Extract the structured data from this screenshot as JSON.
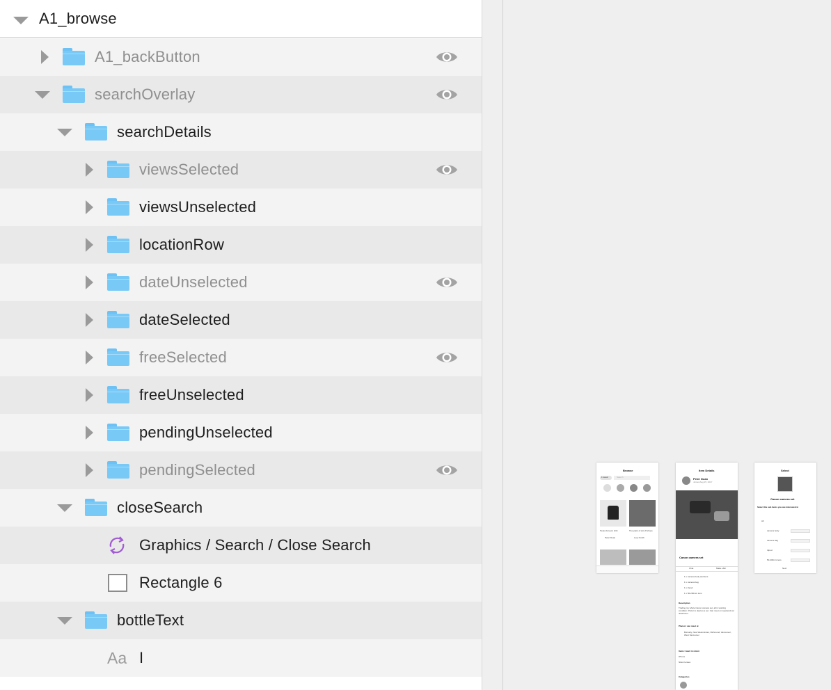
{
  "layers": {
    "root_label": "A1_browse",
    "rows": [
      {
        "label": "A1_backButton",
        "hidden": true,
        "eye": true
      },
      {
        "label": "searchOverlay",
        "hidden": true,
        "eye": true
      },
      {
        "label": "searchDetails",
        "hidden": false,
        "eye": false
      },
      {
        "label": "viewsSelected",
        "hidden": true,
        "eye": true
      },
      {
        "label": "viewsUnselected",
        "hidden": false,
        "eye": false
      },
      {
        "label": "locationRow",
        "hidden": false,
        "eye": false
      },
      {
        "label": "dateUnselected",
        "hidden": true,
        "eye": true
      },
      {
        "label": "dateSelected",
        "hidden": false,
        "eye": false
      },
      {
        "label": "freeSelected",
        "hidden": true,
        "eye": true
      },
      {
        "label": "freeUnselected",
        "hidden": false,
        "eye": false
      },
      {
        "label": "pendingUnselected",
        "hidden": false,
        "eye": false
      },
      {
        "label": "pendingSelected",
        "hidden": true,
        "eye": true
      },
      {
        "label": "closeSearch",
        "hidden": false,
        "eye": false
      },
      {
        "label": "Graphics / Search / Close Search",
        "hidden": false,
        "eye": false
      },
      {
        "label": "Rectangle 6",
        "hidden": false,
        "eye": false
      },
      {
        "label": "bottleText",
        "hidden": false,
        "eye": false
      },
      {
        "label": "I",
        "hidden": false,
        "eye": false
      }
    ]
  },
  "artboards": {
    "browse": {
      "title": "Browse",
      "search_placeholder": "Search",
      "chip": "1 week",
      "item1": "Texas Forever shirt",
      "item2": "Two pairs of size 8 shoes",
      "user1": "Peter Duan",
      "user2": "Lucy Smith"
    },
    "item_details": {
      "title": "Item Details",
      "user": "Peter Duan",
      "posted": "Joined Aug 25, 2017",
      "item_name": "Canon camera set",
      "tab_chat": "Chat",
      "tab_offer": "Make offer",
      "list": [
        "1 x camera body and lens",
        "1 x camera bag",
        "1 x tripod",
        "1 x 50-200mm lens"
      ],
      "desc_heading": "Description",
      "desc_text": "Trading my whole Canon camera set, all in working condition. Prefer to deal as a set. Can meet on weekends at downtown.",
      "place_heading": "Places I can meet at",
      "place_text": "Burnaby, New Westminster, Richmond, Vancouver, West Vancouver",
      "want_heading": "Items I want in return",
      "want1": "iPhone",
      "want2": "Nikon lenses",
      "categories": "Categories"
    },
    "select": {
      "title": "Select",
      "item_name": "Canon camera set",
      "instruction": "Select the sub items you are interested in",
      "options": [
        "All",
        "camera body",
        "camera bag",
        "tripod",
        "50-200mm lens"
      ],
      "next": "Next"
    }
  },
  "colors": {
    "folder": "#79c9f7",
    "symbol": "#a15bd3",
    "row_odd": "#e9e9e9",
    "row_even": "#f3f3f3"
  }
}
